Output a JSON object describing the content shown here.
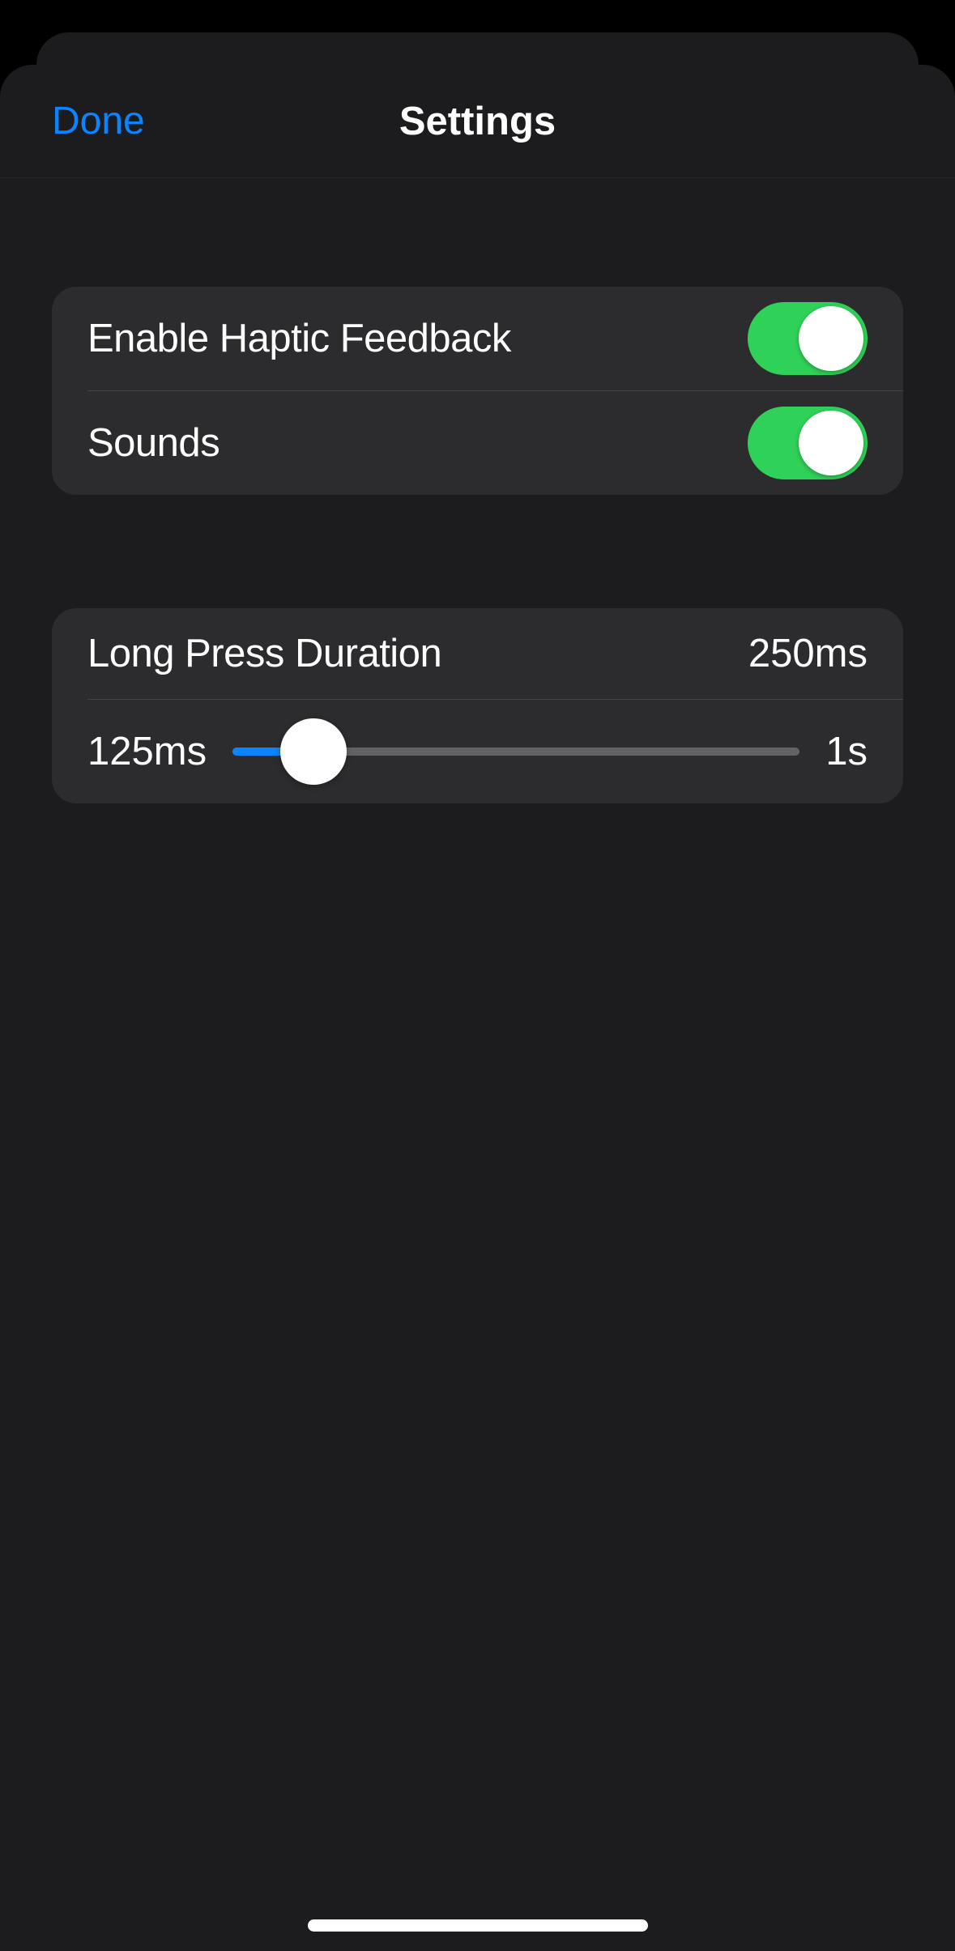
{
  "nav": {
    "done_label": "Done",
    "title": "Settings"
  },
  "feedback_group": {
    "haptic": {
      "label": "Enable Haptic Feedback",
      "on": true
    },
    "sounds": {
      "label": "Sounds",
      "on": true
    }
  },
  "long_press": {
    "label": "Long Press Duration",
    "value_display": "250ms",
    "min_label": "125ms",
    "max_label": "1s",
    "min_ms": 125,
    "max_ms": 1000,
    "value_ms": 250
  }
}
